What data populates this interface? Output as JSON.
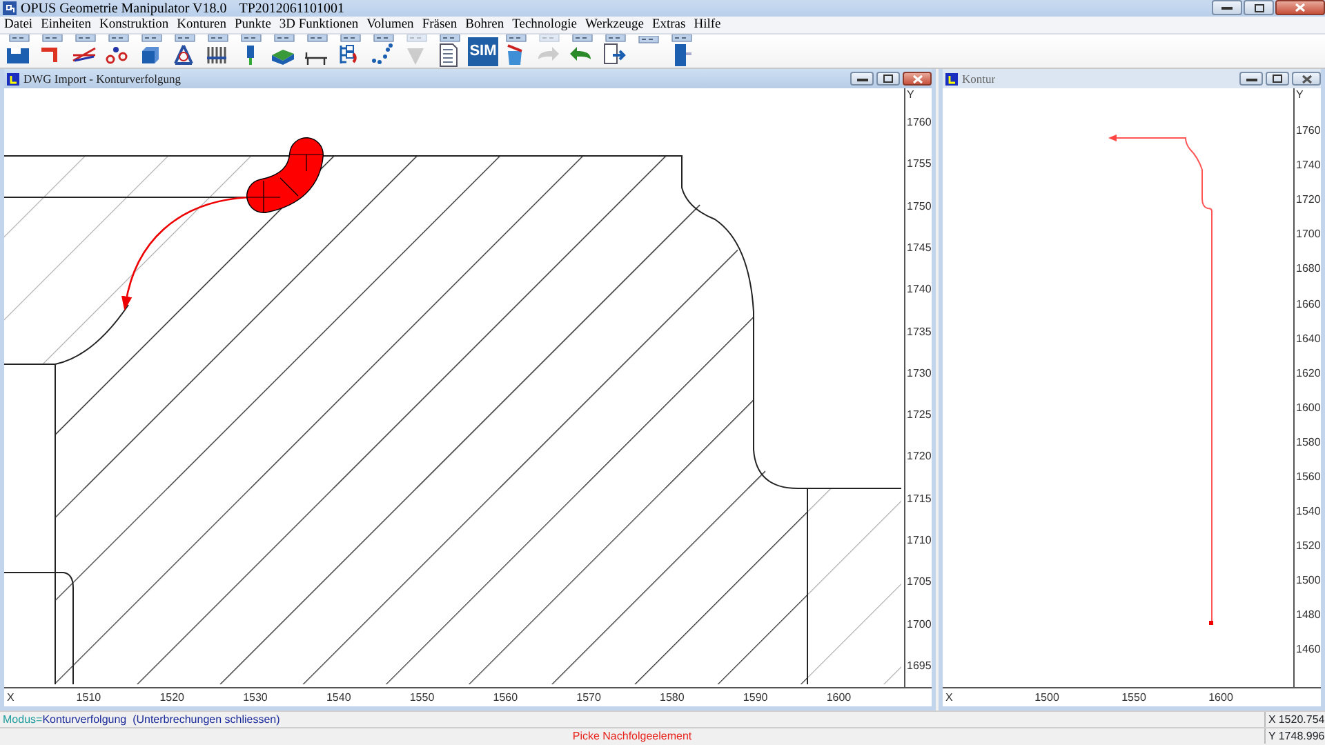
{
  "app": {
    "title": "OPUS Geometrie Manipulator V18.0",
    "file_id": "TP2012061101001"
  },
  "menu": [
    "Datei",
    "Einheiten",
    "Konstruktion",
    "Konturen",
    "Punkte",
    "3D Funktionen",
    "Volumen",
    "Fräsen",
    "Bohren",
    "Technologie",
    "Werkzeuge",
    "Extras",
    "Hilfe"
  ],
  "toolbar": [
    {
      "kind": "icon",
      "disabled": false
    },
    {
      "kind": "icon",
      "disabled": false
    },
    {
      "kind": "icon",
      "disabled": false
    },
    {
      "kind": "icon",
      "disabled": false
    },
    {
      "kind": "icon",
      "disabled": false
    },
    {
      "kind": "icon",
      "disabled": false
    },
    {
      "kind": "icon",
      "disabled": false
    },
    {
      "kind": "icon",
      "disabled": false
    },
    {
      "kind": "icon",
      "disabled": false
    },
    {
      "kind": "icon",
      "disabled": false
    },
    {
      "kind": "icon",
      "disabled": false
    },
    {
      "kind": "icon",
      "disabled": false
    },
    {
      "kind": "icon",
      "disabled": true
    },
    {
      "kind": "icon",
      "disabled": false
    },
    {
      "kind": "text",
      "label": "SIM",
      "disabled": false
    },
    {
      "kind": "icon",
      "disabled": false
    },
    {
      "kind": "icon",
      "disabled": true
    },
    {
      "kind": "icon",
      "disabled": false
    },
    {
      "kind": "icon",
      "disabled": false
    },
    {
      "kind": "tile",
      "disabled": false
    },
    {
      "kind": "icon",
      "disabled": false
    }
  ],
  "windows": [
    {
      "title": "DWG Import - Konturverfolgung",
      "active": true,
      "y_ruler": {
        "axis_label": "Y",
        "ticks": [
          "1760",
          "1755",
          "1750",
          "1745",
          "1740",
          "1735",
          "1730",
          "1725",
          "1720",
          "1715",
          "1710",
          "1705",
          "1700",
          "1695"
        ]
      },
      "x_ruler": {
        "axis_label": "X",
        "ticks": [
          "1510",
          "1520",
          "1530",
          "1540",
          "1550",
          "1560",
          "1570",
          "1580",
          "1590",
          "1600"
        ]
      }
    },
    {
      "title": "Kontur",
      "active": false,
      "y_ruler": {
        "axis_label": "Y",
        "ticks": [
          "1760",
          "1740",
          "1720",
          "1700",
          "1680",
          "1660",
          "1640",
          "1620",
          "1600",
          "1580",
          "1560",
          "1540",
          "1520",
          "1500",
          "1480",
          "1460"
        ]
      },
      "x_ruler": {
        "axis_label": "X",
        "ticks": [
          "1500",
          "1550",
          "1600"
        ]
      }
    }
  ],
  "status_bar": {
    "mode_label": "Modus=",
    "mode_text": "Konturverfolgung  (Unterbrechungen schliessen)",
    "prompt": "Picke Nachfolgeelement",
    "x_label": "X",
    "x_value": "1520.754",
    "y_label": "Y",
    "y_value": "1748.996"
  }
}
